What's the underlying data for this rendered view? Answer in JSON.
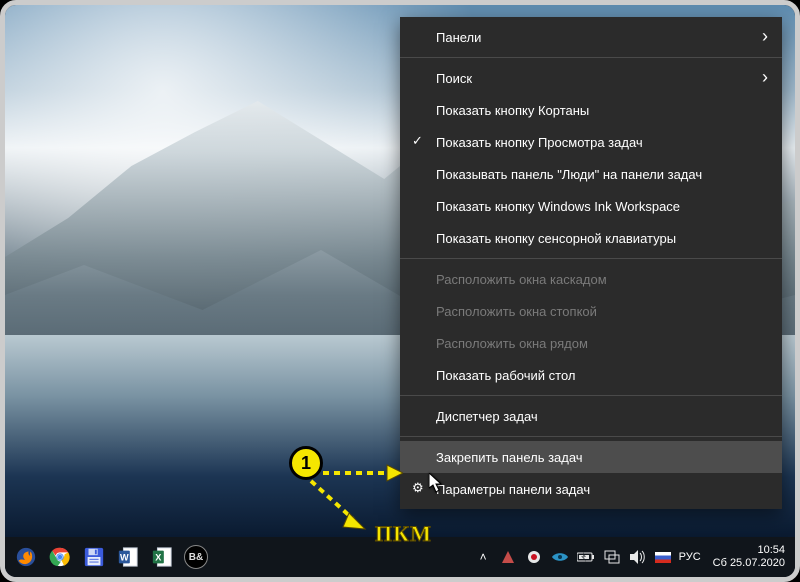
{
  "context_menu": {
    "items": [
      {
        "label": "Панели",
        "submenu": true
      },
      {
        "sep": true
      },
      {
        "label": "Поиск",
        "submenu": true
      },
      {
        "label": "Показать кнопку Кортаны"
      },
      {
        "label": "Показать кнопку Просмотра задач",
        "checked": true
      },
      {
        "label": "Показывать панель \"Люди\" на панели задач"
      },
      {
        "label": "Показать кнопку Windows Ink Workspace"
      },
      {
        "label": "Показать кнопку сенсорной клавиатуры"
      },
      {
        "sep": true
      },
      {
        "label": "Расположить окна каскадом",
        "disabled": true
      },
      {
        "label": "Расположить окна стопкой",
        "disabled": true
      },
      {
        "label": "Расположить окна рядом",
        "disabled": true
      },
      {
        "label": "Показать рабочий стол"
      },
      {
        "sep": true
      },
      {
        "label": "Диспетчер задач"
      },
      {
        "sep": true
      },
      {
        "label": "Закрепить панель задач",
        "hover": true
      },
      {
        "label": "Параметры панели задач",
        "gear": true
      }
    ]
  },
  "annotation": {
    "badge": "1",
    "label": "ПКМ"
  },
  "taskbar": {
    "tray_language": "РУС",
    "clock_time": "10:54",
    "clock_date": "Сб 25.07.2020"
  }
}
